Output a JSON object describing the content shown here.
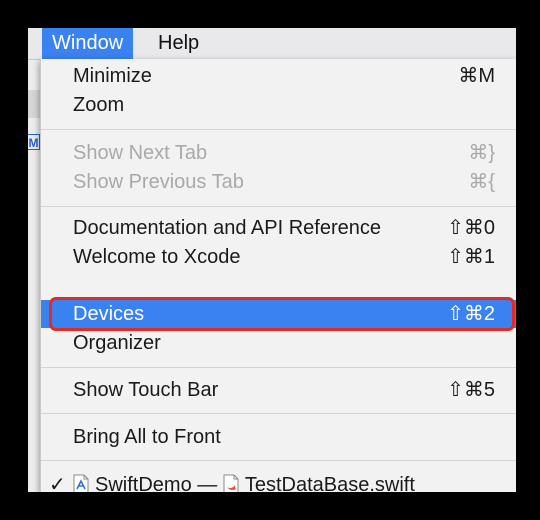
{
  "menubar": {
    "items": [
      {
        "label": "Window",
        "active": true
      },
      {
        "label": "Help",
        "active": false
      }
    ]
  },
  "background": {
    "fragment_text": "M"
  },
  "menu": {
    "groups": [
      [
        {
          "label": "Minimize",
          "shortcut": "⌘M",
          "enabled": true
        },
        {
          "label": "Zoom",
          "shortcut": "",
          "enabled": true
        }
      ],
      [
        {
          "label": "Show Next Tab",
          "shortcut": "⌘}",
          "enabled": false
        },
        {
          "label": "Show Previous Tab",
          "shortcut": "⌘{",
          "enabled": false
        }
      ],
      [
        {
          "label": "Documentation and API Reference",
          "shortcut": "⇧⌘0",
          "enabled": true
        },
        {
          "label": "Welcome to Xcode",
          "shortcut": "⇧⌘1",
          "enabled": true
        },
        {
          "label": "Devices",
          "shortcut": "⇧⌘2",
          "enabled": true,
          "selected": true,
          "highlighted": true
        },
        {
          "label": "Organizer",
          "shortcut": "",
          "enabled": true
        }
      ],
      [
        {
          "label": "Show Touch Bar",
          "shortcut": "⇧⌘5",
          "enabled": true
        }
      ],
      [
        {
          "label": "Bring All to Front",
          "shortcut": "",
          "enabled": true
        }
      ]
    ],
    "window_entry": {
      "check": "✓",
      "project": "SwiftDemo",
      "separator": "—",
      "file": "TestDataBase.swift",
      "project_icon": "xcode-project-icon",
      "file_icon": "swift-file-icon"
    }
  },
  "colors": {
    "selection": "#3a82f0",
    "highlight_ring": "#e52a25",
    "disabled_text": "#a9a9a9"
  }
}
